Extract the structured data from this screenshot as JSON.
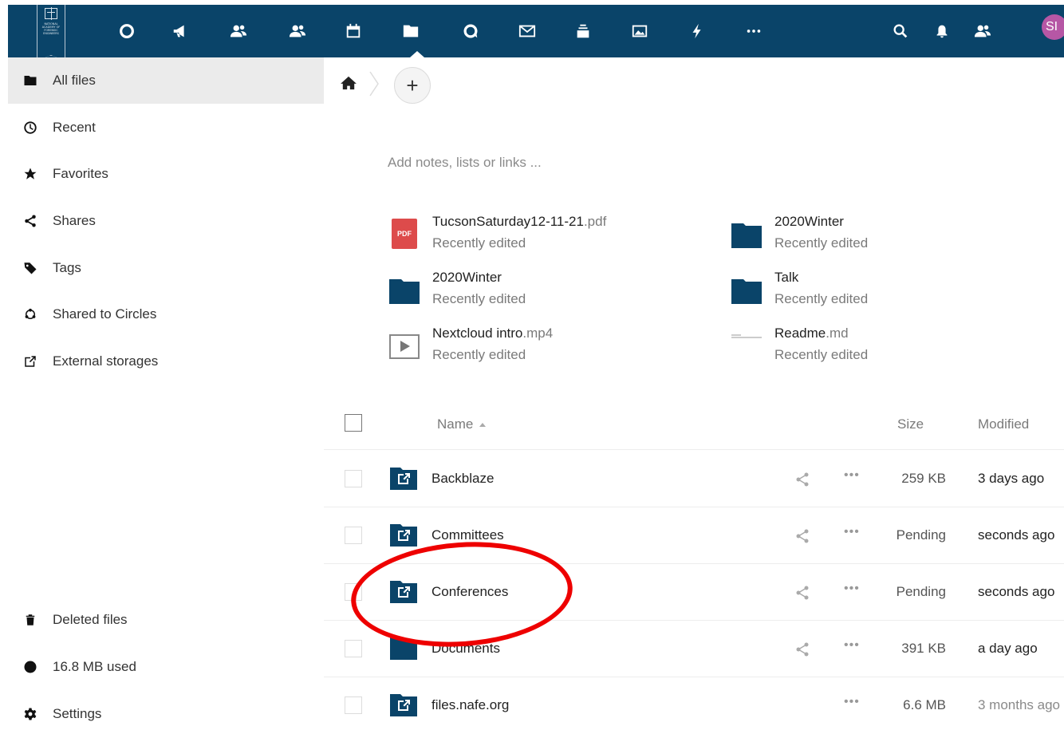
{
  "header": {
    "logo_text": "NATIONAL ACADEMY OF FORENSIC ENGINEERS",
    "apps": [
      {
        "icon": "circle-dashboard-icon",
        "label": "Dashboard"
      },
      {
        "icon": "megaphone-icon",
        "label": "Announcements"
      },
      {
        "icon": "contacts-icon",
        "label": "Contacts"
      },
      {
        "icon": "circles-icon",
        "label": "Circles"
      },
      {
        "icon": "calendar-icon",
        "label": "Calendar"
      },
      {
        "icon": "folder-icon",
        "label": "Files"
      },
      {
        "icon": "talk-icon",
        "label": "Talk"
      },
      {
        "icon": "mail-icon",
        "label": "Mail"
      },
      {
        "icon": "deck-icon",
        "label": "Deck"
      },
      {
        "icon": "photos-icon",
        "label": "Photos"
      },
      {
        "icon": "activity-icon",
        "label": "Activity"
      },
      {
        "icon": "more-apps-icon",
        "label": "More apps"
      }
    ],
    "avatar_initials": "SI",
    "colors": {
      "header_bg": "#0a4469",
      "avatar_bg": "#b657a5"
    }
  },
  "sidebar": {
    "items": [
      {
        "label": "All files",
        "icon": "folder-icon"
      },
      {
        "label": "Recent",
        "icon": "clock-icon"
      },
      {
        "label": "Favorites",
        "icon": "star-icon"
      },
      {
        "label": "Shares",
        "icon": "share-icon"
      },
      {
        "label": "Tags",
        "icon": "tag-icon"
      },
      {
        "label": "Shared to Circles",
        "icon": "circles-icon"
      },
      {
        "label": "External storages",
        "icon": "external-link-icon"
      }
    ],
    "bottom": [
      {
        "label": "Deleted files",
        "icon": "trash-icon"
      },
      {
        "label": "16.8 MB used",
        "icon": "pie-icon"
      },
      {
        "label": "Settings",
        "icon": "gear-icon"
      }
    ]
  },
  "main": {
    "add_label": "+",
    "notes_placeholder": "Add notes, lists or links ...",
    "recent": [
      {
        "name": "TucsonSaturday12-11-21",
        "ext": ".pdf",
        "sub": "Recently edited",
        "type": "pdf",
        "thumb_text": "PDF"
      },
      {
        "name": "2020Winter",
        "ext": "",
        "sub": "Recently edited",
        "type": "folder"
      },
      {
        "name": "2020Winter",
        "ext": "",
        "sub": "Recently edited",
        "type": "folder"
      },
      {
        "name": "Talk",
        "ext": "",
        "sub": "Recently edited",
        "type": "folder"
      },
      {
        "name": "Nextcloud intro",
        "ext": ".mp4",
        "sub": "Recently edited",
        "type": "video"
      },
      {
        "name": "Readme",
        "ext": ".md",
        "sub": "Recently edited",
        "type": "text"
      }
    ],
    "columns": {
      "name": "Name",
      "size": "Size",
      "modified": "Modified"
    },
    "files": [
      {
        "name": "Backblaze",
        "size": "259 KB",
        "modified": "3 days ago",
        "type": "external-folder",
        "shared": true
      },
      {
        "name": "Committees",
        "size": "Pending",
        "modified": "seconds ago",
        "type": "external-folder",
        "shared": true
      },
      {
        "name": "Conferences",
        "size": "Pending",
        "modified": "seconds ago",
        "type": "external-folder",
        "shared": true
      },
      {
        "name": "Documents",
        "size": "391 KB",
        "modified": "a day ago",
        "type": "folder",
        "shared": true
      },
      {
        "name": "files.nafe.org",
        "size": "6.6 MB",
        "modified": "3 months ago",
        "type": "external-folder",
        "shared": false
      }
    ],
    "annotation_color": "#ee0000"
  }
}
